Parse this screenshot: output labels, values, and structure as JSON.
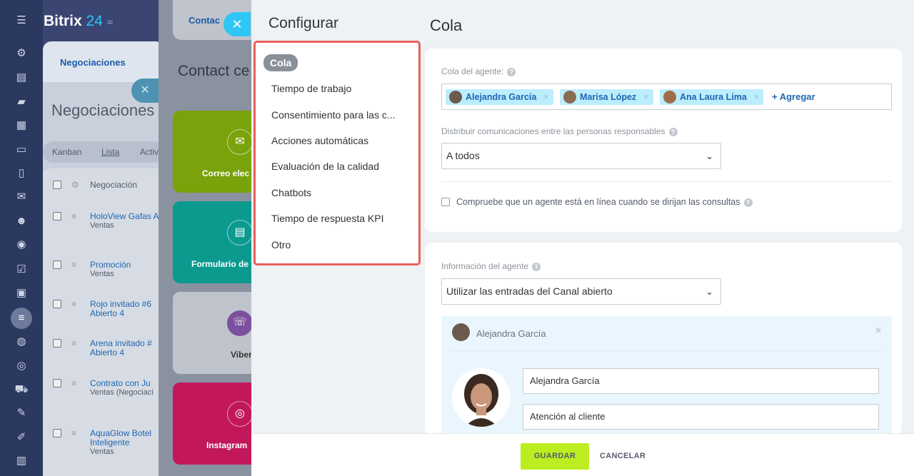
{
  "app": {
    "logo_name": "Bitrix",
    "logo_num": "24",
    "logo_sym": "≈"
  },
  "background": {
    "tab_label": "Negociaciones",
    "page_title": "Negociaciones",
    "views": [
      "Kanban",
      "Lista",
      "Activ"
    ],
    "column_header": "Negociación",
    "rows": [
      {
        "title": "HoloView Gafas Aumentada",
        "sub": "Ventas"
      },
      {
        "title": "Promoción",
        "sub": "Ventas"
      },
      {
        "title": "Rojo invitado #6 Abierto 4",
        "sub": ""
      },
      {
        "title": "Arena invitado # Abierto 4",
        "sub": ""
      },
      {
        "title": "Contrato con Ju",
        "sub": "Ventas (Negociaci"
      },
      {
        "title": "AquaGlow Botel Inteligente",
        "sub": "Ventas"
      }
    ],
    "contact_tab": "Contac",
    "contact_title": "Contact ce",
    "tiles": [
      {
        "label": "Correo elec",
        "icon": "✉",
        "color": "#7aa20b"
      },
      {
        "label": "Formulario de",
        "icon": "▤",
        "color": "#0c9a8f"
      },
      {
        "label": "Viber",
        "icon": "☏",
        "color": "#bfc4cc"
      },
      {
        "label": "Instagram",
        "icon": "◎",
        "color": "#c2175b"
      }
    ]
  },
  "config": {
    "title": "Configurar",
    "menu": [
      "Cola",
      "Tiempo de trabajo",
      "Consentimiento para las c...",
      "Acciones automáticas",
      "Evaluación de la calidad",
      "Chatbots",
      "Tiempo de respuesta KPI",
      "Otro"
    ],
    "active_item": "Cola"
  },
  "page": {
    "title": "Cola",
    "queue_label": "Cola del agente:",
    "agents": [
      "Alejandra García",
      "Marisa López",
      "Ana Laura Lima"
    ],
    "add_label": "+ Agregar",
    "distribute_label": "Distribuir comunicaciones entre las personas responsables",
    "distribute_value": "A todos",
    "check_online_label": "Compruebe que un agente está en línea cuando se dirijan las consultas",
    "agent_info_label": "Información del agente",
    "agent_info_value": "Utilizar las entradas del Canal abierto",
    "agent_card_name": "Alejandra García",
    "agent_name_field": "Alejandra García",
    "agent_dept_field": "Atención al cliente"
  },
  "footer": {
    "save_label": "GUARDAR",
    "cancel_label": "CANCELAR"
  },
  "colors": {
    "accent": "#2fc6f6",
    "save": "#bbed21",
    "highlight": "#e8605a",
    "chip": "#bcedfc"
  }
}
